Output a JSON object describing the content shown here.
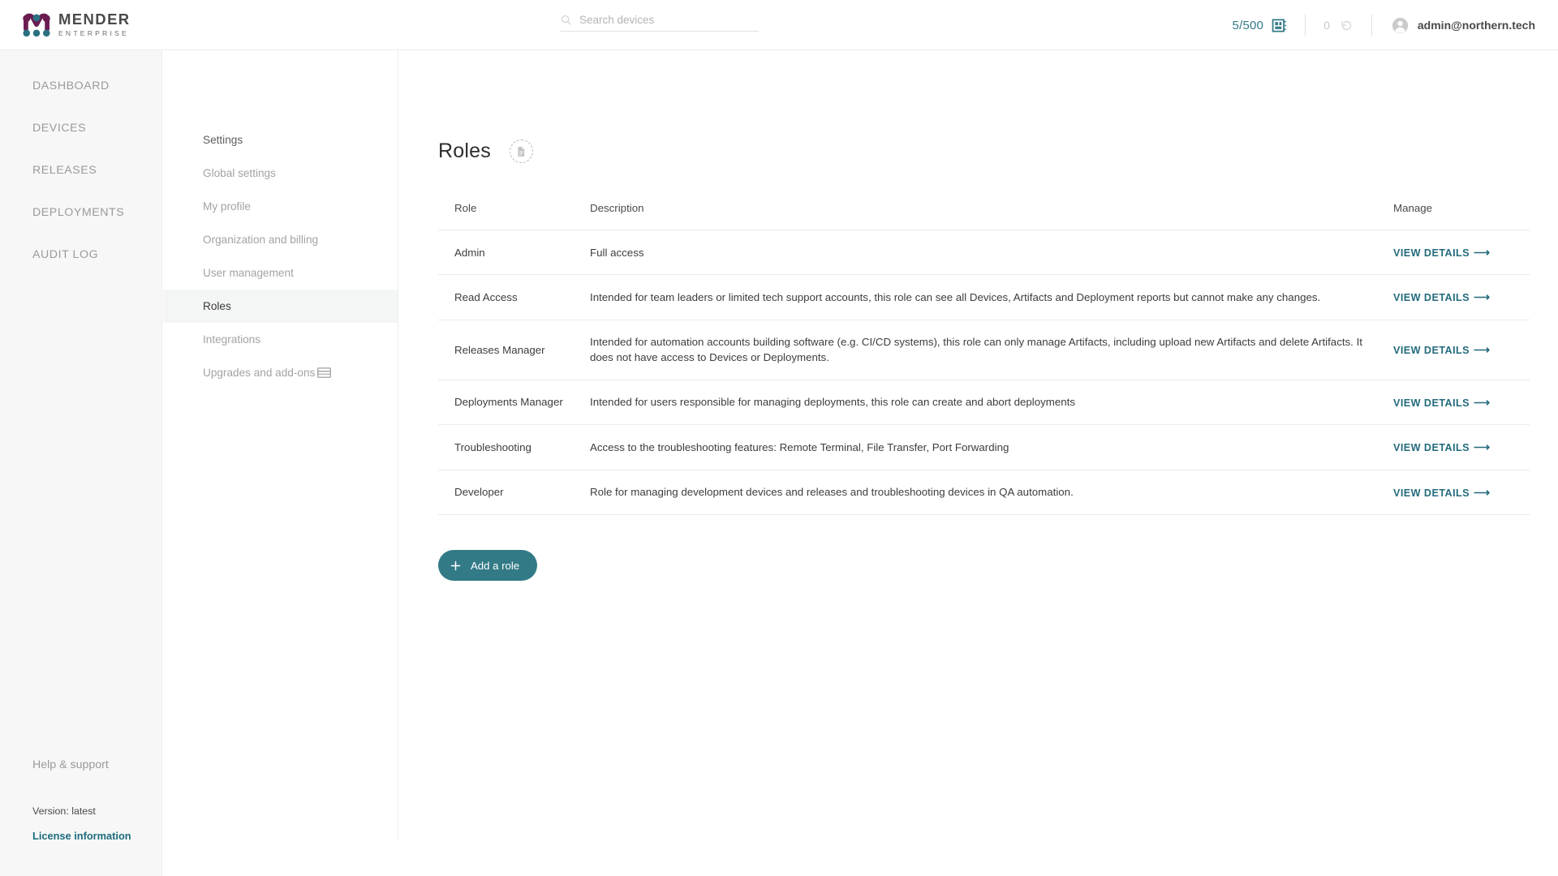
{
  "brand": {
    "name": "MENDER",
    "edition": "ENTERPRISE",
    "logo_purple": "#6a1c50",
    "logo_teal": "#2a7080"
  },
  "header": {
    "search": {
      "placeholder": "Search devices",
      "value": "",
      "icon": "search-icon"
    },
    "device_count": "5/500",
    "device_icon": "chip-icon",
    "pending_count": "0",
    "pending_icon": "refresh-icon",
    "user_email": "admin@northern.tech",
    "avatar_icon": "account-circle-icon"
  },
  "leftnav": {
    "items": [
      {
        "label": "DASHBOARD"
      },
      {
        "label": "DEVICES"
      },
      {
        "label": "RELEASES"
      },
      {
        "label": "DEPLOYMENTS"
      },
      {
        "label": "AUDIT LOG"
      }
    ],
    "help": "Help & support",
    "version": "Version: latest",
    "license": "License information"
  },
  "subnav": {
    "items": [
      {
        "label": "Settings",
        "active": false,
        "head": true
      },
      {
        "label": "Global settings",
        "active": false
      },
      {
        "label": "My profile",
        "active": false
      },
      {
        "label": "Organization and billing",
        "active": false
      },
      {
        "label": "User management",
        "active": false
      },
      {
        "label": "Roles",
        "active": true
      },
      {
        "label": "Integrations",
        "active": false
      },
      {
        "label": "Upgrades and add-ons",
        "active": false,
        "icon": "credit-card-icon"
      }
    ]
  },
  "main": {
    "title": "Roles",
    "title_badge_icon": "document-icon",
    "columns": [
      "Role",
      "Description",
      "Manage"
    ],
    "rows": [
      {
        "role": "Admin",
        "description": "Full access",
        "manage": "VIEW DETAILS"
      },
      {
        "role": "Read Access",
        "description": "Intended for team leaders or limited tech support accounts, this role can see all Devices, Artifacts and Deployment reports but cannot make any changes.",
        "manage": "VIEW DETAILS"
      },
      {
        "role": "Releases Manager",
        "description": "Intended for automation accounts building software (e.g. CI/CD systems), this role can only manage Artifacts, including upload new Artifacts and delete Artifacts. It does not have access to Devices or Deployments.",
        "manage": "VIEW DETAILS"
      },
      {
        "role": "Deployments Manager",
        "description": "Intended for users responsible for managing deployments, this role can create and abort deployments",
        "manage": "VIEW DETAILS"
      },
      {
        "role": "Troubleshooting",
        "description": "Access to the troubleshooting features: Remote Terminal, File Transfer, Port Forwarding",
        "manage": "VIEW DETAILS"
      },
      {
        "role": "Developer",
        "description": "Role for managing development devices and releases and troubleshooting devices in QA automation.",
        "manage": "VIEW DETAILS"
      }
    ],
    "add_button": {
      "label": "Add a role",
      "icon": "plus-icon"
    },
    "arrow_glyph": "⟶"
  },
  "colors": {
    "accent_teal": "#337a87",
    "link_teal": "#236b7c",
    "sidebar_bg": "#f7f7f7",
    "active_bg": "#f4f5f5"
  }
}
